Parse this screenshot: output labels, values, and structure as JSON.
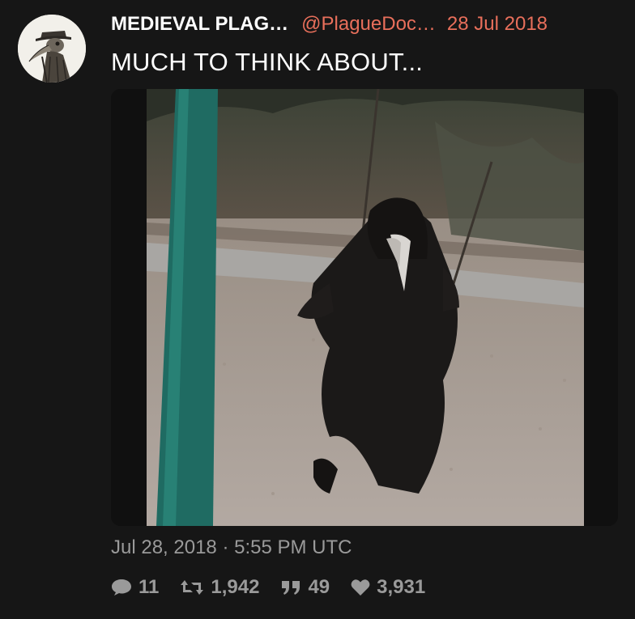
{
  "author": {
    "display_name": "MEDIEVAL PLAG…",
    "handle": "@PlagueDoc…",
    "date": "28 Jul 2018",
    "avatar_icon": "plague-doctor-avatar"
  },
  "tweet": {
    "text": "MUCH TO THINK ABOUT...",
    "media_icon": "plague-doctor-on-swing-photo",
    "timestamp": "Jul 28, 2018 · 5:55 PM UTC"
  },
  "stats": {
    "replies": "11",
    "retweets": "1,942",
    "quotes": "49",
    "likes": "3,931"
  },
  "colors": {
    "background": "#161616",
    "accent": "#e86f5b",
    "muted": "#9a9a9a",
    "text": "#ffffff"
  }
}
